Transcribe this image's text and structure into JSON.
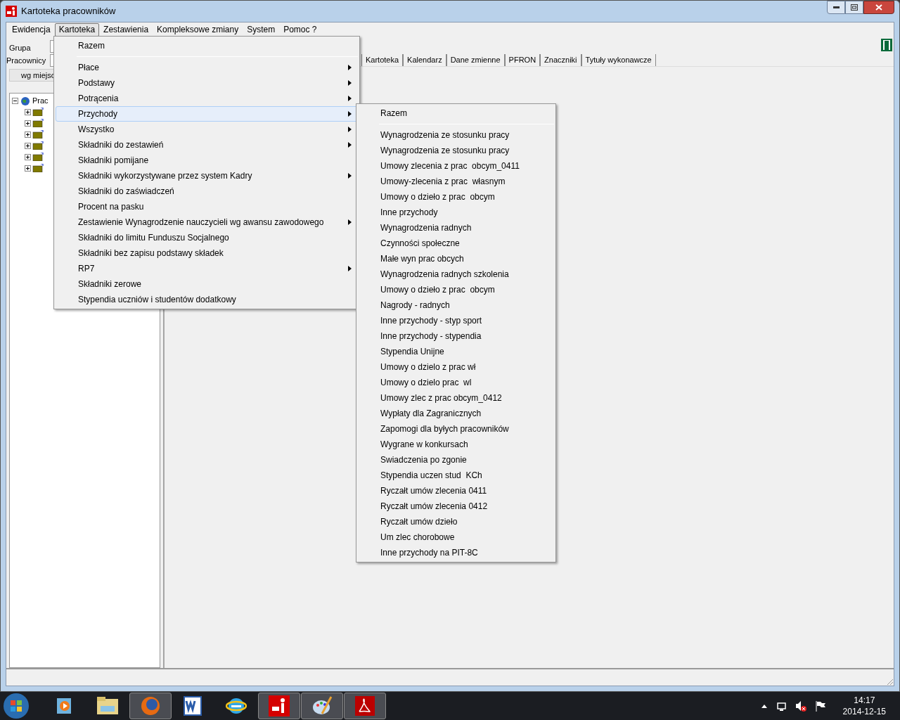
{
  "window": {
    "title": "Kartoteka pracowników"
  },
  "menu_bar": [
    {
      "label": "Ewidencja",
      "selected": false
    },
    {
      "label": "Kartoteka",
      "selected": true
    },
    {
      "label": "Zestawienia",
      "selected": false
    },
    {
      "label": "Kompleksowe zmiany",
      "selected": false
    },
    {
      "label": "System",
      "selected": false
    },
    {
      "label": "Pomoc ?",
      "selected": false
    }
  ],
  "filters": [
    {
      "label": "Grupa"
    },
    {
      "label": "Pracownicy"
    }
  ],
  "group_tab": {
    "label": "wg miejsc"
  },
  "tree": {
    "label": "Prac",
    "expanded": true,
    "children": [
      {
        "expanded": false
      },
      {
        "expanded": false
      },
      {
        "expanded": false
      },
      {
        "expanded": false
      },
      {
        "expanded": false
      },
      {
        "expanded": false
      }
    ]
  },
  "tabs": [
    {
      "label": "Kartoteka"
    },
    {
      "label": "Kalendarz"
    },
    {
      "label": "Dane zmienne"
    },
    {
      "label": "PFRON"
    },
    {
      "label": "Znaczniki"
    },
    {
      "label": "Tytuły wykonawcze"
    }
  ],
  "dropdown": [
    {
      "kind": "item",
      "label": "Razem",
      "submenu": false,
      "selected": false
    },
    {
      "kind": "separator"
    },
    {
      "kind": "item",
      "label": "Płace",
      "submenu": true,
      "selected": false
    },
    {
      "kind": "item",
      "label": "Podstawy",
      "submenu": true,
      "selected": false
    },
    {
      "kind": "item",
      "label": "Potrącenia",
      "submenu": true,
      "selected": false
    },
    {
      "kind": "item",
      "label": "Przychody",
      "submenu": true,
      "selected": true
    },
    {
      "kind": "item",
      "label": "Wszystko",
      "submenu": true,
      "selected": false
    },
    {
      "kind": "item",
      "label": "Składniki do zestawień",
      "submenu": true,
      "selected": false
    },
    {
      "kind": "item",
      "label": "Składniki pomijane",
      "submenu": false,
      "selected": false
    },
    {
      "kind": "item",
      "label": "Składniki wykorzystywane przez system Kadry",
      "submenu": true,
      "selected": false
    },
    {
      "kind": "item",
      "label": "Składniki do zaświadczeń",
      "submenu": false,
      "selected": false
    },
    {
      "kind": "item",
      "label": "Procent na pasku",
      "submenu": false,
      "selected": false
    },
    {
      "kind": "item",
      "label": "Zestawienie Wynagrodzenie nauczycieli wg awansu zawodowego",
      "submenu": true,
      "selected": false
    },
    {
      "kind": "item",
      "label": "Składniki do limitu Funduszu Socjalnego",
      "submenu": false,
      "selected": false
    },
    {
      "kind": "item",
      "label": "Składniki bez zapisu podstawy składek",
      "submenu": false,
      "selected": false
    },
    {
      "kind": "item",
      "label": "RP7",
      "submenu": true,
      "selected": false
    },
    {
      "kind": "item",
      "label": "Składniki zerowe",
      "submenu": false,
      "selected": false
    },
    {
      "kind": "item",
      "label": "Stypendia uczniów i studentów dodatkowy",
      "submenu": false,
      "selected": false
    }
  ],
  "submenu": [
    {
      "kind": "item",
      "label": "Razem"
    },
    {
      "kind": "separator"
    },
    {
      "kind": "item",
      "label": "Wynagrodzenia ze stosunku pracy"
    },
    {
      "kind": "item",
      "label": "Wynagrodzenia ze stosunku pracy"
    },
    {
      "kind": "item",
      "label": "Umowy zlecenia z prac  obcym_0411"
    },
    {
      "kind": "item",
      "label": "Umowy-zlecenia z prac  własnym"
    },
    {
      "kind": "item",
      "label": "Umowy o dzieło z prac  obcym"
    },
    {
      "kind": "item",
      "label": "Inne przychody"
    },
    {
      "kind": "item",
      "label": "Wynagrodzenia radnych"
    },
    {
      "kind": "item",
      "label": "Czynności społeczne"
    },
    {
      "kind": "item",
      "label": "Małe wyn prac obcych"
    },
    {
      "kind": "item",
      "label": "Wynagrodzenia radnych szkolenia"
    },
    {
      "kind": "item",
      "label": "Umowy o dzieło z prac  obcym"
    },
    {
      "kind": "item",
      "label": "Nagrody - radnych"
    },
    {
      "kind": "item",
      "label": "Inne przychody - styp sport"
    },
    {
      "kind": "item",
      "label": "Inne przychody - stypendia"
    },
    {
      "kind": "item",
      "label": "Stypendia Unijne"
    },
    {
      "kind": "item",
      "label": "Umowy o dzielo z prac wł"
    },
    {
      "kind": "item",
      "label": "Umowy o dzielo prac  wl"
    },
    {
      "kind": "item",
      "label": "Umowy zlec z prac obcym_0412"
    },
    {
      "kind": "item",
      "label": "Wypłaty dla Zagranicznych"
    },
    {
      "kind": "item",
      "label": "Zapomogi dla byłych pracowników"
    },
    {
      "kind": "item",
      "label": "Wygrane w konkursach"
    },
    {
      "kind": "item",
      "label": "Swiadczenia po zgonie"
    },
    {
      "kind": "item",
      "label": "Stypendia uczen stud  KCh"
    },
    {
      "kind": "item",
      "label": "Ryczałt umów zlecenia 0411"
    },
    {
      "kind": "item",
      "label": "Ryczałt umów zlecenia 0412"
    },
    {
      "kind": "item",
      "label": "Ryczałt umów dzieło"
    },
    {
      "kind": "item",
      "label": "Um zlec chorobowe"
    },
    {
      "kind": "item",
      "label": "Inne przychody na PIT-8C"
    }
  ],
  "taskbar": {
    "apps": [
      {
        "kind": "media",
        "selected": false
      },
      {
        "kind": "folder",
        "selected": false
      },
      {
        "kind": "browser",
        "selected": true
      },
      {
        "kind": "word",
        "selected": false
      },
      {
        "kind": "ie",
        "selected": false
      },
      {
        "kind": "payroll",
        "selected": true
      },
      {
        "kind": "paint",
        "selected": true
      },
      {
        "kind": "pdf",
        "selected": true
      }
    ],
    "time": "14:17",
    "date": "2014-12-15"
  }
}
